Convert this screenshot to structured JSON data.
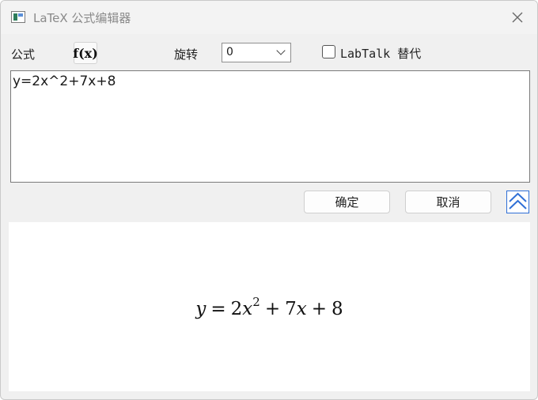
{
  "window": {
    "title": "LaTeX 公式编辑器"
  },
  "toolbar": {
    "formula_label": "公式",
    "fx_button_label": "f(x)",
    "rotate_label": "旋转",
    "rotate_value": "0",
    "labtalk_label": "LabTalk 替代",
    "labtalk_checked": false
  },
  "editor": {
    "value": "y=2x^2+7x+8"
  },
  "actions": {
    "ok_label": "确定",
    "cancel_label": "取消"
  },
  "preview": {
    "y": "y",
    "eq": "=",
    "coef1": "2",
    "x1": "x",
    "exp": "2",
    "plus1": "+",
    "coef2": "7",
    "x2": "x",
    "plus2": "+",
    "const": "8"
  },
  "icons": {
    "app": "latex-app-icon",
    "close": "close-icon",
    "dropdown": "chevron-down-icon",
    "collapse": "double-chevron-up-icon"
  },
  "colors": {
    "accent": "#2f6fd6"
  }
}
